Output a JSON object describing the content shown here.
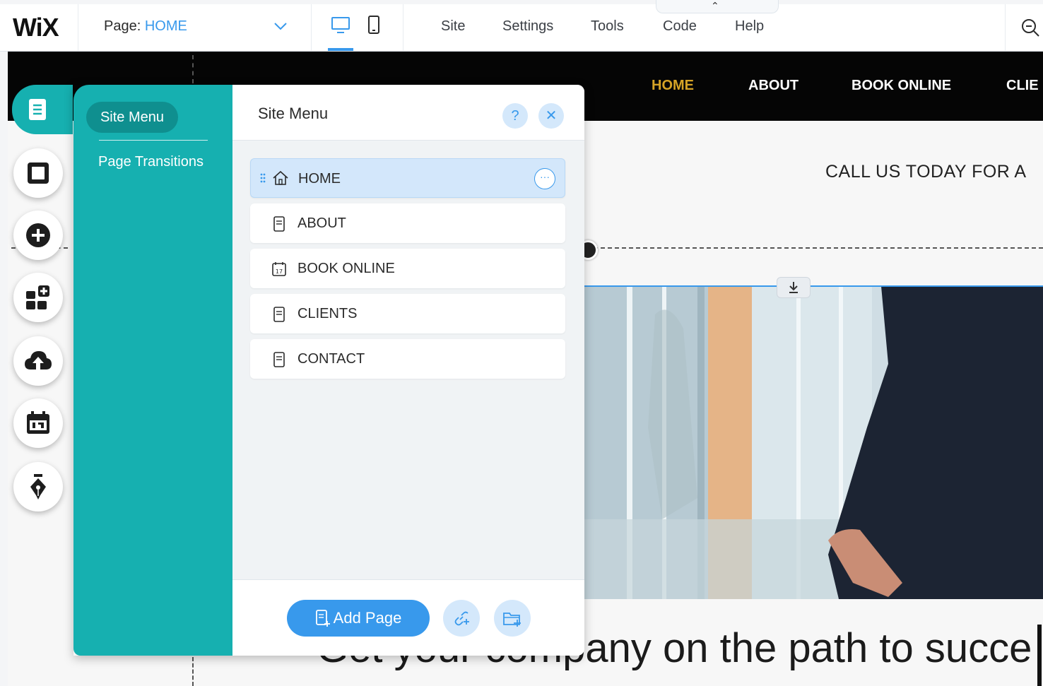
{
  "topbar": {
    "logo": "WiX",
    "page_label": "Page:",
    "page_value": "HOME",
    "menu": [
      "Site",
      "Settings",
      "Tools",
      "Code",
      "Help"
    ]
  },
  "site": {
    "nav": [
      "HOME",
      "ABOUT",
      "BOOK ONLINE",
      "CLIE"
    ],
    "call_text": "CALL US TODAY FOR A",
    "headline": "Get your company on the path to succe"
  },
  "panel": {
    "tabs": [
      "Site Menu",
      "Page Transitions"
    ],
    "title": "Site Menu",
    "help": "?",
    "close": "✕",
    "pages": [
      {
        "label": "HOME",
        "icon": "home-icon"
      },
      {
        "label": "ABOUT",
        "icon": "page-icon"
      },
      {
        "label": "BOOK ONLINE",
        "icon": "calendar-icon"
      },
      {
        "label": "CLIENTS",
        "icon": "page-icon"
      },
      {
        "label": "CONTACT",
        "icon": "page-icon"
      }
    ],
    "add_page": "Add Page"
  },
  "colors": {
    "accent": "#3899ec",
    "teal": "#16b0b0",
    "nav_active": "#d6a326"
  }
}
